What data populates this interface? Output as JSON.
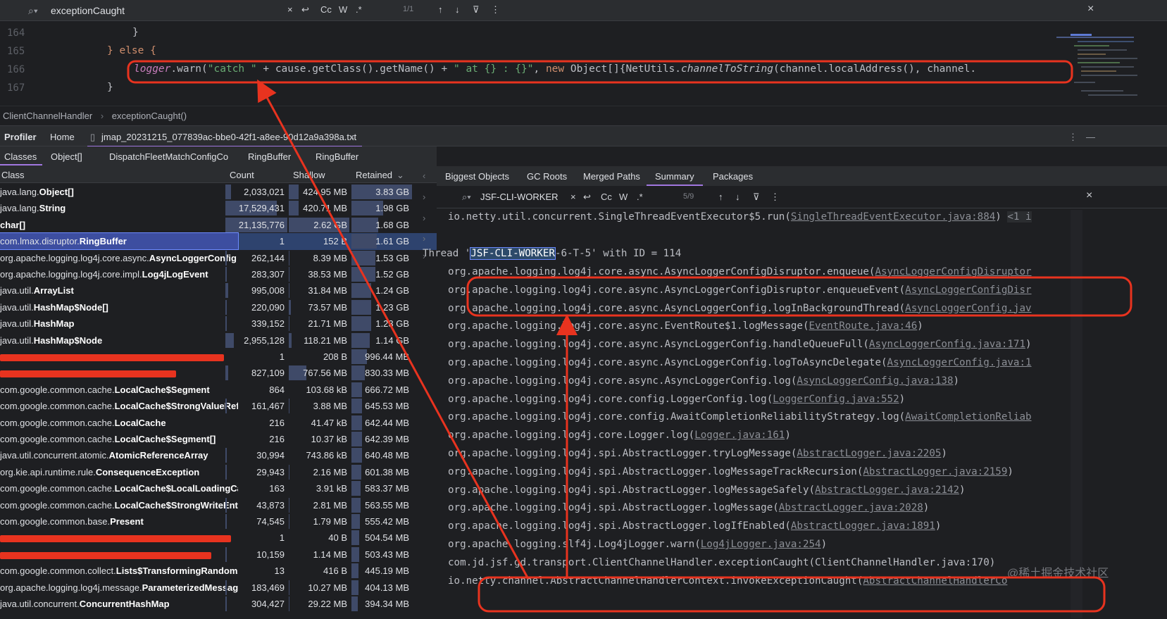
{
  "find": {
    "query": "exceptionCaught",
    "cc": "Cc",
    "w": "W",
    "regex": ".*",
    "count": "1/1"
  },
  "editor": {
    "lines": [
      {
        "no": "164",
        "text": "}"
      },
      {
        "no": "165",
        "text": "} else {"
      },
      {
        "no": "166",
        "p1": "logger",
        "p2": ".warn(",
        "p3": "\"catch \"",
        "p4": " + cause.getClass().getName() + ",
        "p5": "\" at {} : {}\"",
        "p6": ", ",
        "p7": "new",
        "p8": " Object[]{NetUtils.",
        "p9": "channelToString",
        "p10": "(channel.localAddress(), channel."
      },
      {
        "no": "167",
        "text": "}"
      }
    ]
  },
  "breadcrumb": {
    "a": "ClientChannelHandler",
    "sep": "›",
    "b": "exceptionCaught()"
  },
  "ptabs": {
    "profiler": "Profiler",
    "home": "Home",
    "file": "jmap_20231215_077839ac-bbe0-42f1-a8ee-90d12a9a398a.txt",
    "close": "×"
  },
  "stabs": [
    "Classes",
    "Object[]",
    "DispatchFleetMatchConfigCo",
    "RingBuffer",
    "RingBuffer"
  ],
  "table": {
    "headers": {
      "cls": "Class",
      "count": "Count",
      "shallow": "Shallow",
      "retained": "Retained"
    },
    "rows": [
      {
        "pre": "java.lang.",
        "bold": "Object[]",
        "count": "2,033,021",
        "shallow": "424.95 MB",
        "retained": "3.83 GB",
        "cf": 0.096,
        "sf": 0.16,
        "rf": 1.0
      },
      {
        "pre": "java.lang.",
        "bold": "String",
        "count": "17,529,431",
        "shallow": "420.71 MB",
        "retained": "1.98 GB",
        "cf": 0.83,
        "sf": 0.16,
        "rf": 0.52
      },
      {
        "pre": "",
        "bold": "char[]",
        "count": "21,135,776",
        "shallow": "2.62 GB",
        "retained": "1.68 GB",
        "cf": 1.0,
        "sf": 1.0,
        "rf": 0.44
      },
      {
        "pre": "com.lmax.disruptor.",
        "bold": "RingBuffer",
        "count": "1",
        "shallow": "152 B",
        "retained": "1.61 GB",
        "cf": 0,
        "sf": 0,
        "rf": 0.42,
        "sel": true
      },
      {
        "pre": "org.apache.logging.log4j.core.async.",
        "bold": "AsyncLoggerConfig",
        "count": "262,144",
        "shallow": "8.39 MB",
        "retained": "1.53 GB",
        "cf": 0.012,
        "sf": 0.003,
        "rf": 0.4
      },
      {
        "pre": "org.apache.logging.log4j.core.impl.",
        "bold": "Log4jLogEvent",
        "count": "283,307",
        "shallow": "38.53 MB",
        "retained": "1.52 GB",
        "cf": 0.013,
        "sf": 0.015,
        "rf": 0.4
      },
      {
        "pre": "java.util.",
        "bold": "ArrayList",
        "count": "995,008",
        "shallow": "31.84 MB",
        "retained": "1.24 GB",
        "cf": 0.047,
        "sf": 0.012,
        "rf": 0.32
      },
      {
        "pre": "java.util.",
        "bold": "HashMap$Node[]",
        "count": "220,090",
        "shallow": "73.57 MB",
        "retained": "1.23 GB",
        "cf": 0.01,
        "sf": 0.03,
        "rf": 0.32
      },
      {
        "pre": "java.util.",
        "bold": "HashMap",
        "count": "339,152",
        "shallow": "21.71 MB",
        "retained": "1.23 GB",
        "cf": 0.016,
        "sf": 0.008,
        "rf": 0.32
      },
      {
        "pre": "java.util.",
        "bold": "HashMap$Node",
        "count": "2,955,128",
        "shallow": "118.21 MB",
        "retained": "1.14 GB",
        "cf": 0.14,
        "sf": 0.045,
        "rf": 0.3
      },
      {
        "redact": true,
        "count": "1",
        "shallow": "208 B",
        "retained": "996.44 MB",
        "cf": 0,
        "sf": 0,
        "rf": 0.26
      },
      {
        "redact": true,
        "count": "827,109",
        "shallow": "767.56 MB",
        "retained": "830.33 MB",
        "cf": 0.04,
        "sf": 0.29,
        "rf": 0.22
      },
      {
        "pre": "com.google.common.cache.",
        "bold": "LocalCache$Segment",
        "count": "864",
        "shallow": "103.68 kB",
        "retained": "666.72 MB",
        "cf": 0,
        "sf": 0,
        "rf": 0.17
      },
      {
        "pre": "com.google.common.cache.",
        "bold": "LocalCache$StrongValueReference",
        "count": "161,467",
        "shallow": "3.88 MB",
        "retained": "645.53 MB",
        "cf": 0.008,
        "sf": 0.001,
        "rf": 0.17
      },
      {
        "pre": "com.google.common.cache.",
        "bold": "LocalCache",
        "count": "216",
        "shallow": "41.47 kB",
        "retained": "642.44 MB",
        "cf": 0,
        "sf": 0,
        "rf": 0.17
      },
      {
        "pre": "com.google.common.cache.",
        "bold": "LocalCache$Segment[]",
        "count": "216",
        "shallow": "10.37 kB",
        "retained": "642.39 MB",
        "cf": 0,
        "sf": 0,
        "rf": 0.17
      },
      {
        "pre": "java.util.concurrent.atomic.",
        "bold": "AtomicReferenceArray",
        "count": "30,994",
        "shallow": "743.86 kB",
        "retained": "640.48 MB",
        "cf": 0.002,
        "sf": 0,
        "rf": 0.17
      },
      {
        "pre": "org.kie.api.runtime.rule.",
        "bold": "ConsequenceException",
        "count": "29,943",
        "shallow": "2.16 MB",
        "retained": "601.38 MB",
        "cf": 0.002,
        "sf": 0.001,
        "rf": 0.16
      },
      {
        "pre": "com.google.common.cache.",
        "bold": "LocalCache$LocalLoadingCache",
        "count": "163",
        "shallow": "3.91 kB",
        "retained": "583.37 MB",
        "cf": 0,
        "sf": 0,
        "rf": 0.15
      },
      {
        "pre": "com.google.common.cache.",
        "bold": "LocalCache$StrongWriteEntry",
        "count": "43,873",
        "shallow": "2.81 MB",
        "retained": "563.55 MB",
        "cf": 0.002,
        "sf": 0.001,
        "rf": 0.15
      },
      {
        "pre": "com.google.common.base.",
        "bold": "Present",
        "count": "74,545",
        "shallow": "1.79 MB",
        "retained": "555.42 MB",
        "cf": 0.004,
        "sf": 0.001,
        "rf": 0.14
      },
      {
        "redact": true,
        "count": "1",
        "shallow": "40 B",
        "retained": "504.54 MB",
        "cf": 0,
        "sf": 0,
        "rf": 0.13
      },
      {
        "redact": true,
        "count": "10,159",
        "shallow": "1.14 MB",
        "retained": "503.43 MB",
        "cf": 0.001,
        "sf": 0,
        "rf": 0.13
      },
      {
        "pre": "com.google.common.collect.",
        "bold": "Lists$TransformingRandomAccessList",
        "count": "13",
        "shallow": "416 B",
        "retained": "445.19 MB",
        "cf": 0,
        "sf": 0,
        "rf": 0.12
      },
      {
        "pre": "org.apache.logging.log4j.message.",
        "bold": "ParameterizedMessage",
        "count": "183,469",
        "shallow": "10.27 MB",
        "retained": "404.13 MB",
        "cf": 0.009,
        "sf": 0.004,
        "rf": 0.11
      },
      {
        "pre": "java.util.concurrent.",
        "bold": "ConcurrentHashMap",
        "count": "304,427",
        "shallow": "29.22 MB",
        "retained": "394.34 MB",
        "cf": 0.014,
        "sf": 0.011,
        "rf": 0.1
      }
    ]
  },
  "rtabs": [
    "Biggest Objects",
    "GC Roots",
    "Merged Paths",
    "Summary",
    "Packages"
  ],
  "rfind": {
    "query": "JSF-CLI-WORKER",
    "cc": "Cc",
    "w": "W",
    "regex": ".*",
    "count": "5/9"
  },
  "thread": {
    "first": {
      "m": "io.netty.util.concurrent.SingleThreadEventExecutor$5.run(",
      "l": "SingleThreadEventExecutor.java:884",
      "e": ")",
      "more": "<1 i"
    },
    "head_pre": "Thread '",
    "head_hl": "JSF-CLI-WORKER",
    "head_post": "-6-T-5' with ID = 114",
    "frames": [
      {
        "m": "org.apache.logging.log4j.core.async.AsyncLoggerConfigDisruptor.enqueue(",
        "l": "AsyncLoggerConfigDisruptor",
        "e": ""
      },
      {
        "m": "org.apache.logging.log4j.core.async.AsyncLoggerConfigDisruptor.enqueueEvent(",
        "l": "AsyncLoggerConfigDisr",
        "e": ""
      },
      {
        "m": "org.apache.logging.log4j.core.async.AsyncLoggerConfig.logInBackgroundThread(",
        "l": "AsyncLoggerConfig.jav",
        "e": ""
      },
      {
        "m": "org.apache.logging.log4j.core.async.EventRoute$1.logMessage(",
        "l": "EventRoute.java:46",
        "e": ")"
      },
      {
        "m": "org.apache.logging.log4j.core.async.AsyncLoggerConfig.handleQueueFull(",
        "l": "AsyncLoggerConfig.java:171",
        "e": ")"
      },
      {
        "m": "org.apache.logging.log4j.core.async.AsyncLoggerConfig.logToAsyncDelegate(",
        "l": "AsyncLoggerConfig.java:1",
        "e": ""
      },
      {
        "m": "org.apache.logging.log4j.core.async.AsyncLoggerConfig.log(",
        "l": "AsyncLoggerConfig.java:138",
        "e": ")"
      },
      {
        "m": "org.apache.logging.log4j.core.config.LoggerConfig.log(",
        "l": "LoggerConfig.java:552",
        "e": ")"
      },
      {
        "m": "org.apache.logging.log4j.core.config.AwaitCompletionReliabilityStrategy.log(",
        "l": "AwaitCompletionReliab",
        "e": ""
      },
      {
        "m": "org.apache.logging.log4j.core.Logger.log(",
        "l": "Logger.java:161",
        "e": ")"
      },
      {
        "m": "org.apache.logging.log4j.spi.AbstractLogger.tryLogMessage(",
        "l": "AbstractLogger.java:2205",
        "e": ")"
      },
      {
        "m": "org.apache.logging.log4j.spi.AbstractLogger.logMessageTrackRecursion(",
        "l": "AbstractLogger.java:2159",
        "e": ")"
      },
      {
        "m": "org.apache.logging.log4j.spi.AbstractLogger.logMessageSafely(",
        "l": "AbstractLogger.java:2142",
        "e": ")"
      },
      {
        "m": "org.apache.logging.log4j.spi.AbstractLogger.logMessage(",
        "l": "AbstractLogger.java:2028",
        "e": ")"
      },
      {
        "m": "org.apache.logging.log4j.spi.AbstractLogger.logIfEnabled(",
        "l": "AbstractLogger.java:1891",
        "e": ")"
      },
      {
        "m": "org.apache.logging.slf4j.Log4jLogger.warn(",
        "l": "Log4jLogger.java:254",
        "e": ")"
      },
      {
        "m": "com.jd.jsf.gd.transport.ClientChannelHandler.exceptionCaught(ClientChannelHandler.java:170)",
        "l": "",
        "e": ""
      },
      {
        "m": "io.netty.channel.AbstractChannelHandlerContext.invokeExceptionCaught(",
        "l": "AbstractChannelHandlerCo",
        "e": ""
      }
    ]
  },
  "watermark": "@稀土掘金技术社区",
  "colors": {
    "accent": "#a177e0",
    "annot": "#e8331f",
    "select": "#2e436e"
  }
}
